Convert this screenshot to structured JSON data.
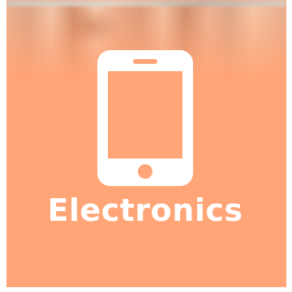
{
  "category": {
    "label": "Electronics",
    "icon": "smartphone-icon",
    "background_color": "#ffa577",
    "foreground_color": "#ffffff"
  }
}
